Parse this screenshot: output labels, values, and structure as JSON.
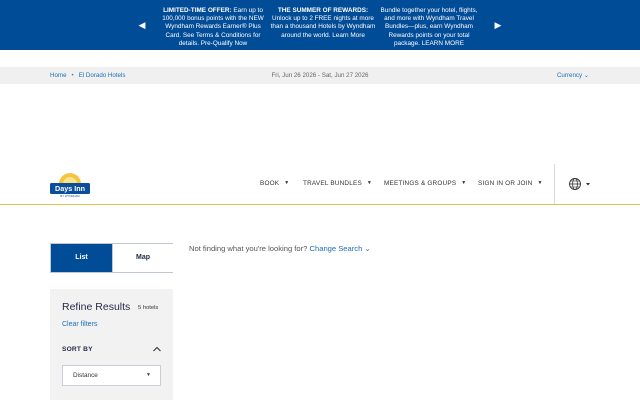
{
  "promo": {
    "slides": [
      {
        "title": "LIMITED-TIME OFFER:",
        "text": " Earn up to 100,000 bonus points with the NEW Wyndham Rewards Earner® Plus Card. See Terms & Conditions for details. Pre-Qualify Now"
      },
      {
        "title": "THE SUMMER OF REWARDS:",
        "text": " Unlock up to 2 FREE nights at more than a thousand Hotels by Wyndham around the world. Learn More"
      },
      {
        "title": "",
        "text": "Bundle together your hotel, flights, and more with Wyndham Travel Bundles—plus, earn Wyndham Rewards points on your total package. LEARN MORE"
      }
    ],
    "prev_icon": "chevron-left-icon",
    "next_icon": "chevron-right-icon",
    "background": "#004c97"
  },
  "utility": {
    "breadcrumbs": [
      "Home",
      "El Dorado Hotels"
    ],
    "breadcrumb_separator": "•",
    "dates": "Fri, Jun 26 2026 - Sat, Jun 27 2026",
    "currency": "Currency"
  },
  "header": {
    "logo": {
      "brand": "Days Inn",
      "sub": "BY WYNDHAM"
    },
    "nav": {
      "book": "BOOK",
      "bundles": "TRAVEL BUNDLES",
      "meetings": "MEETINGS & GROUPS",
      "signin": "SIGN IN OR JOIN"
    },
    "globe_icon": "globe-icon",
    "accent": "#e0c44c"
  },
  "results": {
    "tabs": {
      "list": "List",
      "map": "Map"
    },
    "not_finding": "Not finding what you're looking for?",
    "change_search": "Change Search"
  },
  "refine": {
    "title": "Refine Results",
    "count": "5 hotels",
    "clear": "Clear filters",
    "sort_label": "SORT BY",
    "sort_value": "Distance"
  }
}
